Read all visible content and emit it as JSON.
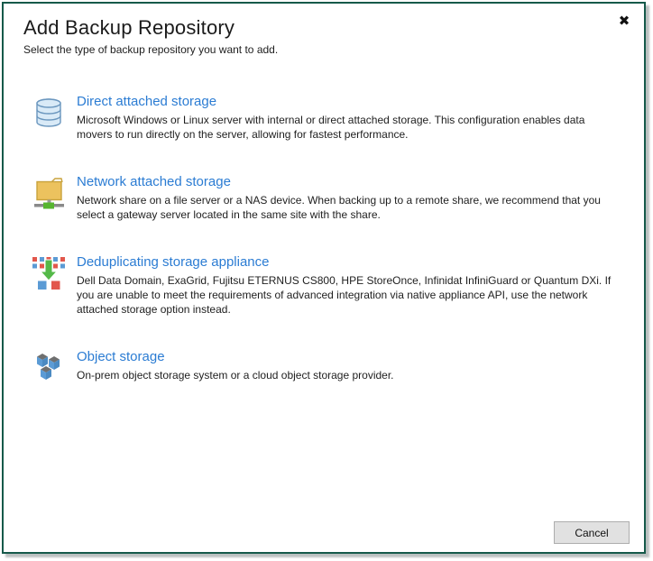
{
  "dialog": {
    "title": "Add Backup Repository",
    "subtitle": "Select the type of backup repository you want to add.",
    "close_glyph": "✖",
    "border_color": "#15594a",
    "link_color": "#2b7cd3"
  },
  "options": [
    {
      "id": "direct-attached-storage",
      "icon": "database-icon",
      "title": "Direct attached storage",
      "description": "Microsoft Windows or Linux server with internal or direct attached storage. This configuration enables data movers to run directly on the server, allowing for fastest performance."
    },
    {
      "id": "network-attached-storage",
      "icon": "network-folder-icon",
      "title": "Network attached storage",
      "description": "Network share on a file server or a NAS device. When backing up to a remote share, we recommend that you select a gateway server located in the same site with the share."
    },
    {
      "id": "deduplicating-storage-appliance",
      "icon": "dedup-appliance-icon",
      "title": "Deduplicating storage appliance",
      "description": "Dell Data Domain, ExaGrid, Fujitsu ETERNUS CS800, HPE StoreOnce, Infinidat InfiniGuard or Quantum DXi. If you are unable to meet the requirements of advanced integration via native appliance API, use the network attached storage option instead."
    },
    {
      "id": "object-storage",
      "icon": "object-storage-icon",
      "title": "Object storage",
      "description": "On-prem object storage system or a cloud object storage provider."
    }
  ],
  "footer": {
    "cancel_label": "Cancel"
  }
}
